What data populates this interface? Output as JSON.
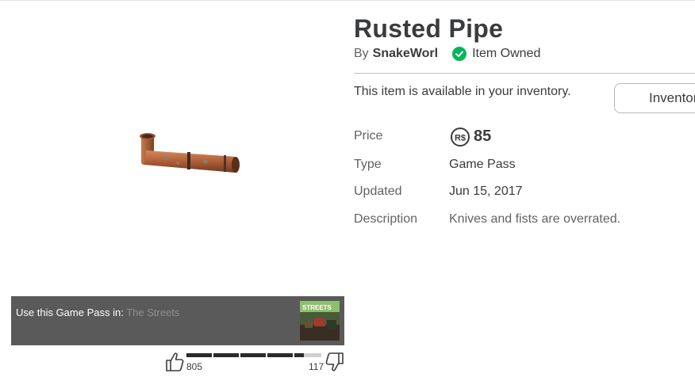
{
  "item": {
    "title": "Rusted Pipe",
    "by_prefix": "By",
    "creator": "SnakeWorl",
    "owned_label": "Item Owned",
    "availability": "This item is available in your inventory.",
    "inventory_button": "Inventory"
  },
  "details": {
    "price_label": "Price",
    "price_value": "85",
    "type_label": "Type",
    "type_value": "Game Pass",
    "updated_label": "Updated",
    "updated_value": "Jun 15, 2017",
    "description_label": "Description",
    "description_value": "Knives and fists are overrated."
  },
  "game": {
    "use_text": "Use this Game Pass in:",
    "game_name": "The Streets",
    "thumbnail_text": "STREETS"
  },
  "votes": {
    "up": "805",
    "down": "117",
    "up_fraction": 0.873
  },
  "colors": {
    "owned_green": "#02b757",
    "text": "#393b3d",
    "muted": "#606264"
  },
  "icons": {
    "owned": "check-circle-icon",
    "currency": "robux-icon",
    "thumbs_up": "thumbs-up-icon",
    "thumbs_down": "thumbs-down-icon"
  }
}
